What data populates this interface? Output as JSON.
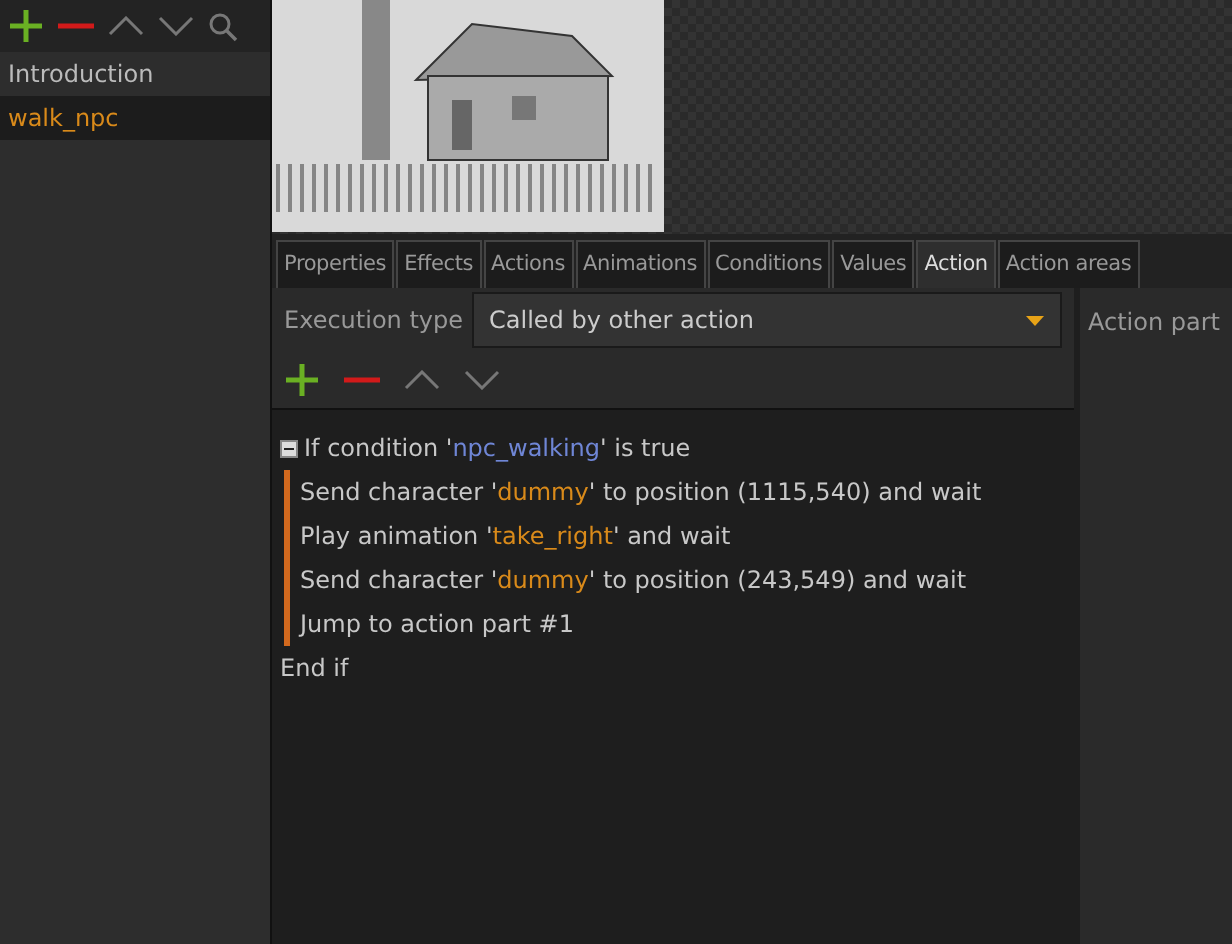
{
  "sidebar": {
    "items": [
      {
        "label": "Introduction",
        "selected": false
      },
      {
        "label": "walk_npc",
        "selected": true
      }
    ]
  },
  "tabs": [
    {
      "label": "Properties",
      "selected": false
    },
    {
      "label": "Effects",
      "selected": false
    },
    {
      "label": "Actions",
      "selected": false
    },
    {
      "label": "Animations",
      "selected": false
    },
    {
      "label": "Conditions",
      "selected": false
    },
    {
      "label": "Values",
      "selected": false
    },
    {
      "label": "Action",
      "selected": true
    },
    {
      "label": "Action areas",
      "selected": false
    }
  ],
  "execution_type": {
    "label": "Execution type",
    "value": "Called by other action"
  },
  "script": [
    {
      "kind": "if",
      "expanded": true,
      "segments": [
        {
          "kind": "plain",
          "text": "If condition '"
        },
        {
          "kind": "condition",
          "text": "npc_walking"
        },
        {
          "kind": "plain",
          "text": "' is true"
        }
      ],
      "children": [
        {
          "segments": [
            {
              "kind": "plain",
              "text": "Send character '"
            },
            {
              "kind": "name",
              "text": "dummy"
            },
            {
              "kind": "plain",
              "text": "' to position (1115,540) and wait"
            }
          ]
        },
        {
          "segments": [
            {
              "kind": "plain",
              "text": "Play animation '"
            },
            {
              "kind": "name",
              "text": "take_right"
            },
            {
              "kind": "plain",
              "text": "' and wait"
            }
          ]
        },
        {
          "segments": [
            {
              "kind": "plain",
              "text": "Send character '"
            },
            {
              "kind": "name",
              "text": "dummy"
            },
            {
              "kind": "plain",
              "text": "' to position (243,549) and wait"
            }
          ]
        },
        {
          "segments": [
            {
              "kind": "plain",
              "text": "Jump to action part #1"
            }
          ]
        }
      ]
    },
    {
      "kind": "end",
      "segments": [
        {
          "kind": "plain",
          "text": "End if"
        }
      ]
    }
  ],
  "action_part": {
    "label": "Action part"
  }
}
